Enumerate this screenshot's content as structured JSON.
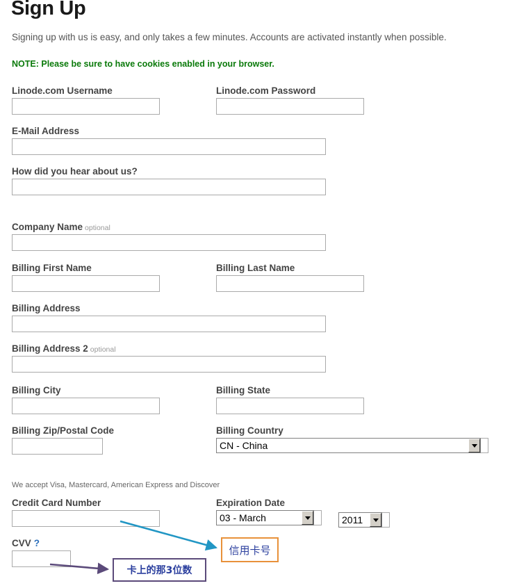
{
  "page": {
    "title": "Sign Up",
    "intro": "Signing up with us is easy, and only takes a few minutes. Accounts are activated instantly when possible.",
    "note": "NOTE: Please be sure to have cookies enabled in your browser.",
    "payment_note": "We accept Visa, Mastercard, American Express and Discover"
  },
  "fields": {
    "username": {
      "label": "Linode.com Username",
      "value": ""
    },
    "password": {
      "label": "Linode.com Password",
      "value": ""
    },
    "email": {
      "label": "E-Mail Address",
      "value": ""
    },
    "referral": {
      "label": "How did you hear about us?",
      "value": ""
    },
    "company": {
      "label": "Company Name",
      "optional": "optional",
      "value": ""
    },
    "first_name": {
      "label": "Billing First Name",
      "value": ""
    },
    "last_name": {
      "label": "Billing Last Name",
      "value": ""
    },
    "address1": {
      "label": "Billing Address",
      "value": ""
    },
    "address2": {
      "label": "Billing Address 2",
      "optional": "optional",
      "value": ""
    },
    "city": {
      "label": "Billing City",
      "value": ""
    },
    "state": {
      "label": "Billing State",
      "value": ""
    },
    "zip": {
      "label": "Billing Zip/Postal Code",
      "value": ""
    },
    "country": {
      "label": "Billing Country",
      "selected": "CN - China"
    },
    "card_number": {
      "label": "Credit Card Number",
      "value": ""
    },
    "expiration": {
      "label": "Expiration Date",
      "month": "03 - March",
      "year": "2011"
    },
    "cvv": {
      "label": "CVV",
      "help": "?",
      "value": ""
    }
  },
  "annotations": {
    "credit_card": {
      "text": "信用卡号",
      "border_color": "#e8913a",
      "text_color": "#2b3f9e"
    },
    "cvv": {
      "text": "卡上的那3位数",
      "border_color": "#5b4a7a",
      "text_color": "#2b3f9e"
    },
    "arrow_credit_card_color": "#2196c4",
    "arrow_cvv_color": "#5b4a7a"
  },
  "colors": {
    "note_green": "#0a7a0a",
    "label_gray": "#444444",
    "input_border": "#aaaaaa",
    "link_blue": "#2a6ebb"
  }
}
